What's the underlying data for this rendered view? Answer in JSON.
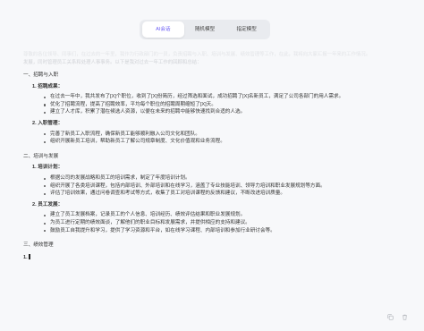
{
  "tabs": [
    {
      "label": "AI会话",
      "active": true
    },
    {
      "label": "随机模型",
      "active": false
    },
    {
      "label": "指定模型",
      "active": false
    }
  ],
  "intro": [
    "尊敬的各位领导、同事们，在过去的一年里，我作为行政部门的一员，负责招聘与入职、培训与发展、绩效管理等工作，在此，我将向大家汇报一年来的工作情况。",
    "发展，同时管理员工关系和处理人事事务。以下是我对过去一年工作的回顾和总结："
  ],
  "doc": {
    "s1_title": "一、招聘与入职",
    "s1_1_title": "1. 招聘成果：",
    "s1_1_items": [
      "在过去一年中，我共发布了[X]个职位，收到了[X]份简历，经过筛选和面试，成功招聘了[X]名新员工，满足了公司各部门的用人需求。",
      "优化了招聘流程，提高了招聘效率，平均每个职位的招聘周期缩短了[X]天。",
      "建立了人才库，积累了潜在候选人资源，以便在未来的招聘中能够快速找到合适的人选。"
    ],
    "s1_2_title": "2. 入职管理：",
    "s1_2_items": [
      "完善了新员工入职流程，确保新员工能够顺利融入公司文化和团队。",
      "组织开展新员工培训，帮助新员工了解公司规章制度、文化价值观和业务流程。"
    ],
    "s2_title": "二、培训与发展",
    "s2_1_title": "1. 培训计划：",
    "s2_1_items": [
      "根据公司的发展战略和员工的培训需求，制定了年度培训计划。",
      "组织开展了各类培训课程，包括内部培训、外部培训和在线学习，涵盖了专业技能培训、领导力培训和职业发展规划等方面。",
      "评估了培训效果，通过问卷调查和考试等方式，收集了员工对培训课程的反馈和建议，不断改进培训质量。"
    ],
    "s2_2_title": "2. 员工发展：",
    "s2_2_items": [
      "建立了员工发展档案，记录员工的个人信息、培训经历、绩效评估结果和职业发展规划。",
      "为员工进行定期的绩效面谈，了解他们的职业目标和发展需求，并提供相应的支持和建议。",
      "鼓励员工自我提升和学习，提供了学习资源和平台，如在线学习课程、内部培训和参加行业研讨会等。"
    ],
    "s3_title": "三、绩效管理",
    "s3_1_title": "1."
  },
  "icons": {
    "copy": "copy-icon",
    "delete": "trash-icon"
  },
  "colors": {
    "accent": "#6a5cf5",
    "background": "#f7f8fa"
  }
}
